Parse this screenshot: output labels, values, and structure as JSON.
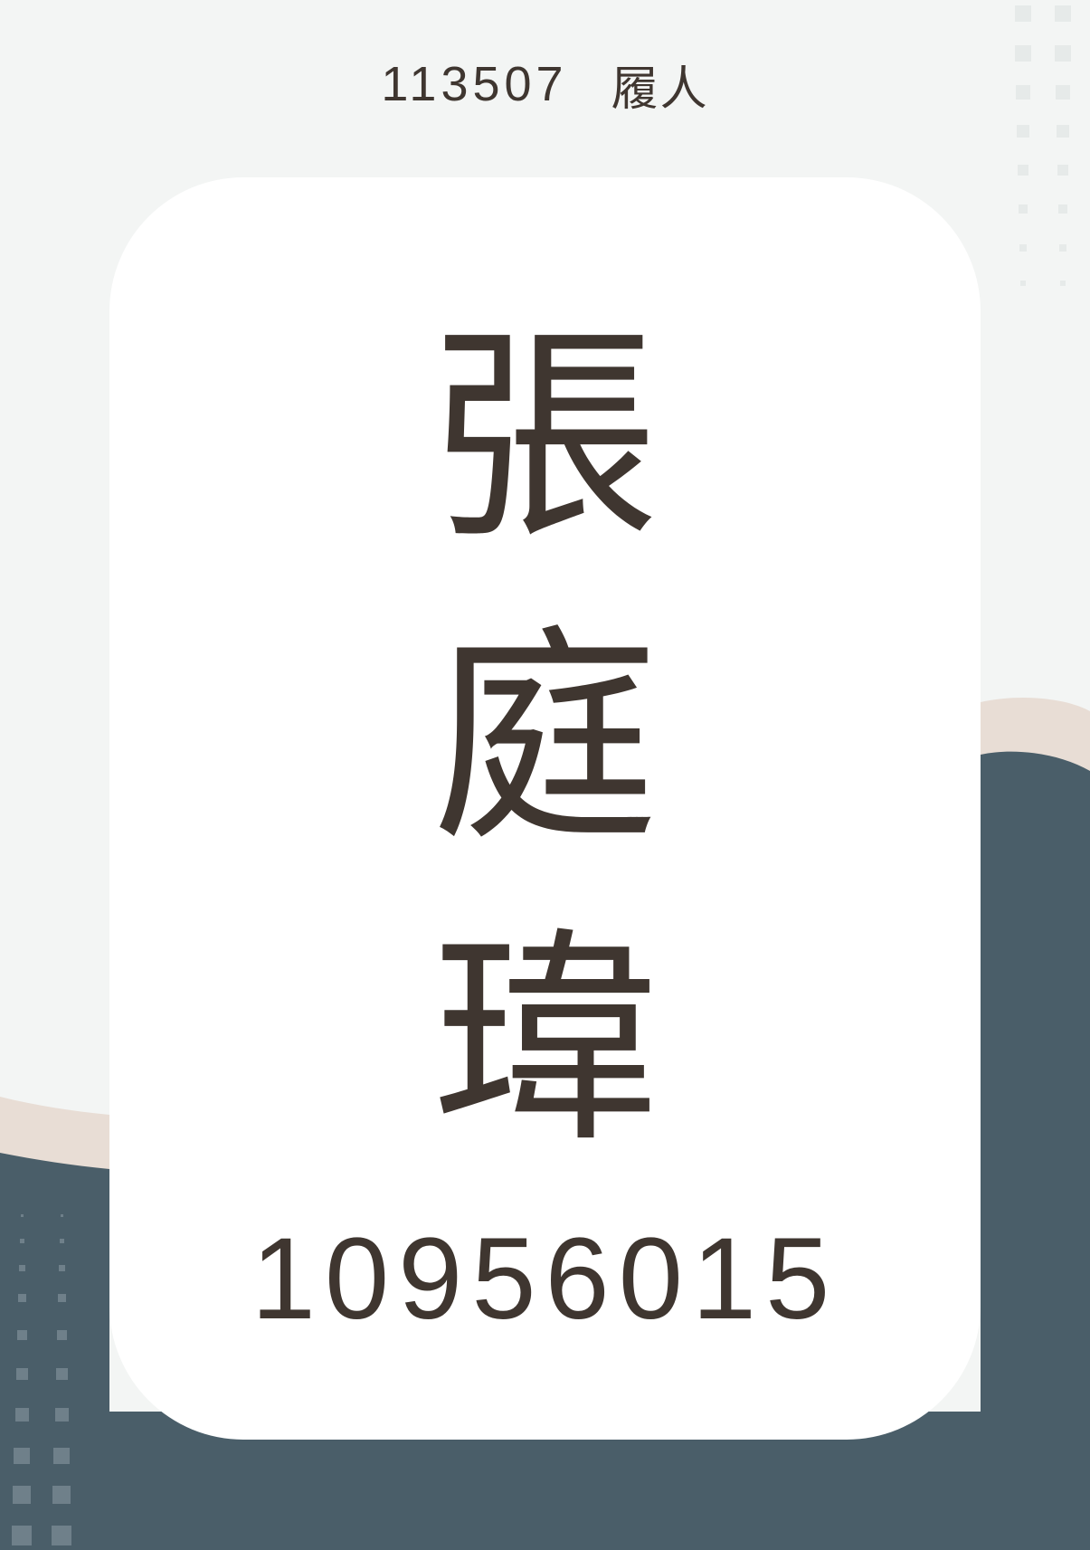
{
  "header": {
    "code": "113507",
    "label": "履人"
  },
  "card": {
    "name_chars": [
      "張",
      "庭",
      "瑋"
    ],
    "student_id": "10956015"
  },
  "colors": {
    "background": "#f3f5f4",
    "card": "#ffffff",
    "text": "#3f3630",
    "wave_beige": "#e8ddd5",
    "wave_slate": "#4a5e69"
  }
}
